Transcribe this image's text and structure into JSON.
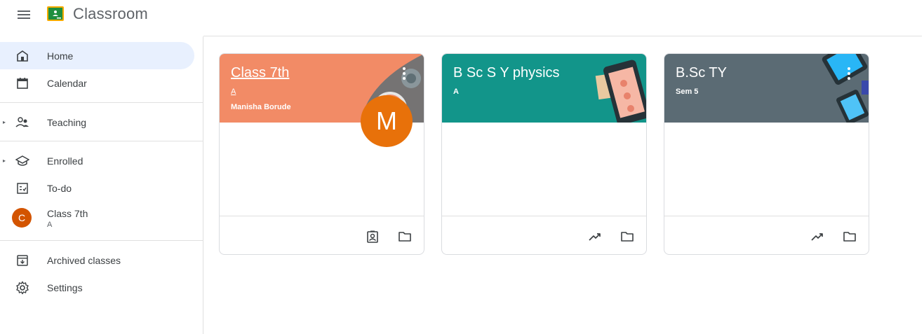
{
  "app": {
    "title": "Classroom"
  },
  "sidebar": {
    "items": [
      {
        "label": "Home"
      },
      {
        "label": "Calendar"
      },
      {
        "label": "Teaching"
      },
      {
        "label": "Enrolled"
      },
      {
        "label": "To-do"
      },
      {
        "label": "Class 7th",
        "sub": "A",
        "avatar": "C"
      },
      {
        "label": "Archived classes"
      },
      {
        "label": "Settings"
      }
    ]
  },
  "cards": [
    {
      "title": "Class 7th",
      "section": "A",
      "teacher": "Manisha Borude",
      "avatar_letter": "M",
      "color": "#f28b66"
    },
    {
      "title": "B Sc S Y physics",
      "section": "A",
      "color": "#12958a"
    },
    {
      "title": "B.Sc TY",
      "section": "Sem 5",
      "color": "#5b6b74"
    }
  ],
  "colors": {
    "accent": "#e8f0fe",
    "logo": "#1e8e3e",
    "avatar_c": "#d35400",
    "avatar_m": "#e8710a"
  }
}
